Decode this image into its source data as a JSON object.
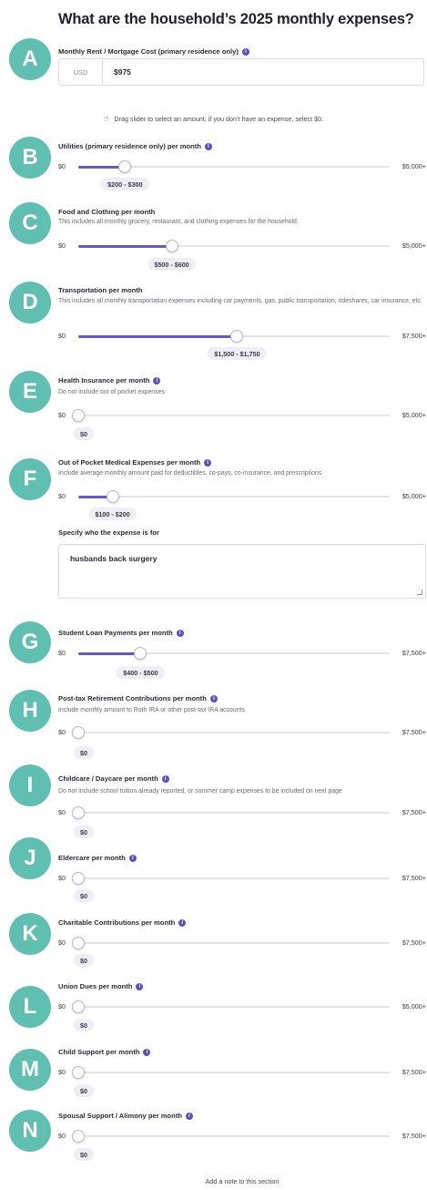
{
  "title": "What are the household’s 2025 monthly expenses?",
  "mortgage": {
    "badge": "A",
    "label": "Monthly Rent / Mortgage Cost (primary residence only)",
    "currency": "USD",
    "value": "$975"
  },
  "hint": "Drag slider to select an amount, if you don’t have an expense, select $0.",
  "sliders": [
    {
      "badge": "B",
      "label": "Utilities (primary residence only) per month",
      "info": true,
      "desc": "",
      "min": "$0",
      "max": "$5,000+",
      "value_label": "$200 - $300",
      "fraction": 0.15
    },
    {
      "badge": "C",
      "label": "Food and Clothing per month",
      "info": false,
      "desc": "This includes all monthly grocery, restaurant, and clothing expenses for the household.",
      "min": "$0",
      "max": "$5,000+",
      "value_label": "$500 - $600",
      "fraction": 0.3
    },
    {
      "badge": "D",
      "label": "Transportation per month",
      "info": false,
      "desc": "This includes all monthly transportation expenses including car payments, gas, public transportation, rideshares, car insurance, etc.",
      "min": "$0",
      "max": "$7,500+",
      "value_label": "$1,500 - $1,750",
      "fraction": 0.51
    },
    {
      "badge": "E",
      "label": "Health Insurance per month",
      "info": true,
      "desc": "Do not include out of pocket expenses",
      "min": "$0",
      "max": "$5,000+",
      "value_label": "$0",
      "fraction": 0
    },
    {
      "badge": "F",
      "label": "Out of Pocket Medical Expenses per month",
      "info": true,
      "desc": "Include average monthly amount paid for deductibles, co-pays, co-insurance, and prescriptions",
      "min": "$0",
      "max": "$5,000+",
      "value_label": "$100 - $200",
      "fraction": 0.11
    },
    {
      "badge": "G",
      "label": "Student Loan Payments per month",
      "info": true,
      "desc": "",
      "min": "$0",
      "max": "$7,500+",
      "value_label": "$400 - $500",
      "fraction": 0.2
    },
    {
      "badge": "H",
      "label": "Post-tax Retirement Contributions per month",
      "info": true,
      "desc": "Include monthly amount to Roth IRA or other post-tax IRA accounts",
      "min": "$0",
      "max": "$7,500+",
      "value_label": "$0",
      "fraction": 0
    },
    {
      "badge": "I",
      "label": "Childcare / Daycare per month",
      "info": true,
      "desc": "Do not include school tuition already reported, or summer camp expenses to be included on next page",
      "min": "$0",
      "max": "$7,500+",
      "value_label": "$0",
      "fraction": 0
    },
    {
      "badge": "J",
      "label": "Eldercare per month",
      "info": true,
      "desc": "",
      "min": "$0",
      "max": "$7,500+",
      "value_label": "$0",
      "fraction": 0
    },
    {
      "badge": "K",
      "label": "Charitable Contributions per month",
      "info": true,
      "desc": "",
      "min": "$0",
      "max": "$7,500+",
      "value_label": "$0",
      "fraction": 0
    },
    {
      "badge": "L",
      "label": "Union Dues per month",
      "info": true,
      "desc": "",
      "min": "$0",
      "max": "$5,000+",
      "value_label": "$0",
      "fraction": 0
    },
    {
      "badge": "M",
      "label": "Child Support per month",
      "info": true,
      "desc": "",
      "min": "$0",
      "max": "$7,500+",
      "value_label": "$0",
      "fraction": 0
    },
    {
      "badge": "N",
      "label": "Spousal Support / Alimony per month",
      "info": true,
      "desc": "",
      "min": "$0",
      "max": "$7,500+",
      "value_label": "$0",
      "fraction": 0
    }
  ],
  "who": {
    "label": "Specify who the expense is for",
    "value": "husbands back surgery"
  },
  "add_note": "Add a note to this section",
  "colors": {
    "badge": "#5fbfb0",
    "accent": "#6557cf"
  }
}
